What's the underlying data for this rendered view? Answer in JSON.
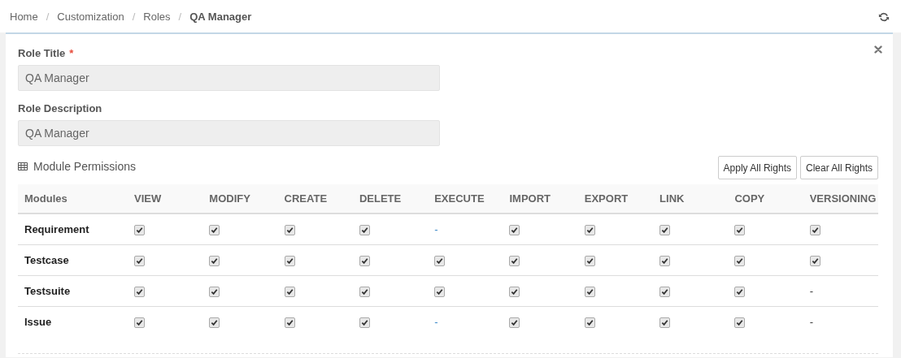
{
  "breadcrumb": [
    {
      "label": "Home",
      "current": false
    },
    {
      "label": "Customization",
      "current": false
    },
    {
      "label": "Roles",
      "current": false
    },
    {
      "label": "QA Manager",
      "current": true
    }
  ],
  "breadcrumb_separator": "/",
  "form": {
    "fields": [
      {
        "label": "Role Title",
        "required_mark": "*",
        "value": "QA Manager"
      },
      {
        "label": "Role Description",
        "value": "QA Manager"
      }
    ]
  },
  "permissions": {
    "title": "Module Permissions",
    "buttons": [
      "Apply All Rights",
      "Clear All Rights"
    ],
    "columns": [
      "Modules",
      "VIEW",
      "MODIFY",
      "CREATE",
      "DELETE",
      "EXECUTE",
      "IMPORT",
      "EXPORT",
      "LINK",
      "COPY",
      "VERSIONING"
    ],
    "rows": [
      {
        "module": "Requirement",
        "cells": [
          {
            "kind": "checkbox",
            "checked": true
          },
          {
            "kind": "checkbox",
            "checked": true
          },
          {
            "kind": "checkbox",
            "checked": true
          },
          {
            "kind": "checkbox",
            "checked": true
          },
          {
            "kind": "link",
            "text": "-"
          },
          {
            "kind": "checkbox",
            "checked": true
          },
          {
            "kind": "checkbox",
            "checked": true
          },
          {
            "kind": "checkbox",
            "checked": true
          },
          {
            "kind": "checkbox",
            "checked": true
          },
          {
            "kind": "checkbox",
            "checked": true
          }
        ]
      },
      {
        "module": "Testcase",
        "cells": [
          {
            "kind": "checkbox",
            "checked": true
          },
          {
            "kind": "checkbox",
            "checked": true
          },
          {
            "kind": "checkbox",
            "checked": true
          },
          {
            "kind": "checkbox",
            "checked": true
          },
          {
            "kind": "checkbox",
            "checked": true
          },
          {
            "kind": "checkbox",
            "checked": true
          },
          {
            "kind": "checkbox",
            "checked": true
          },
          {
            "kind": "checkbox",
            "checked": true
          },
          {
            "kind": "checkbox",
            "checked": true
          },
          {
            "kind": "checkbox",
            "checked": true
          }
        ]
      },
      {
        "module": "Testsuite",
        "cells": [
          {
            "kind": "checkbox",
            "checked": true
          },
          {
            "kind": "checkbox",
            "checked": true
          },
          {
            "kind": "checkbox",
            "checked": true
          },
          {
            "kind": "checkbox",
            "checked": true
          },
          {
            "kind": "checkbox",
            "checked": true
          },
          {
            "kind": "checkbox",
            "checked": true
          },
          {
            "kind": "checkbox",
            "checked": true
          },
          {
            "kind": "checkbox",
            "checked": true
          },
          {
            "kind": "checkbox",
            "checked": true
          },
          {
            "kind": "dash",
            "text": "-"
          }
        ]
      },
      {
        "module": "Issue",
        "cells": [
          {
            "kind": "checkbox",
            "checked": true
          },
          {
            "kind": "checkbox",
            "checked": true
          },
          {
            "kind": "checkbox",
            "checked": true
          },
          {
            "kind": "checkbox",
            "checked": true
          },
          {
            "kind": "link",
            "text": "-"
          },
          {
            "kind": "checkbox",
            "checked": true
          },
          {
            "kind": "checkbox",
            "checked": true
          },
          {
            "kind": "checkbox",
            "checked": true
          },
          {
            "kind": "checkbox",
            "checked": true
          },
          {
            "kind": "dash",
            "text": "-"
          }
        ]
      }
    ]
  }
}
